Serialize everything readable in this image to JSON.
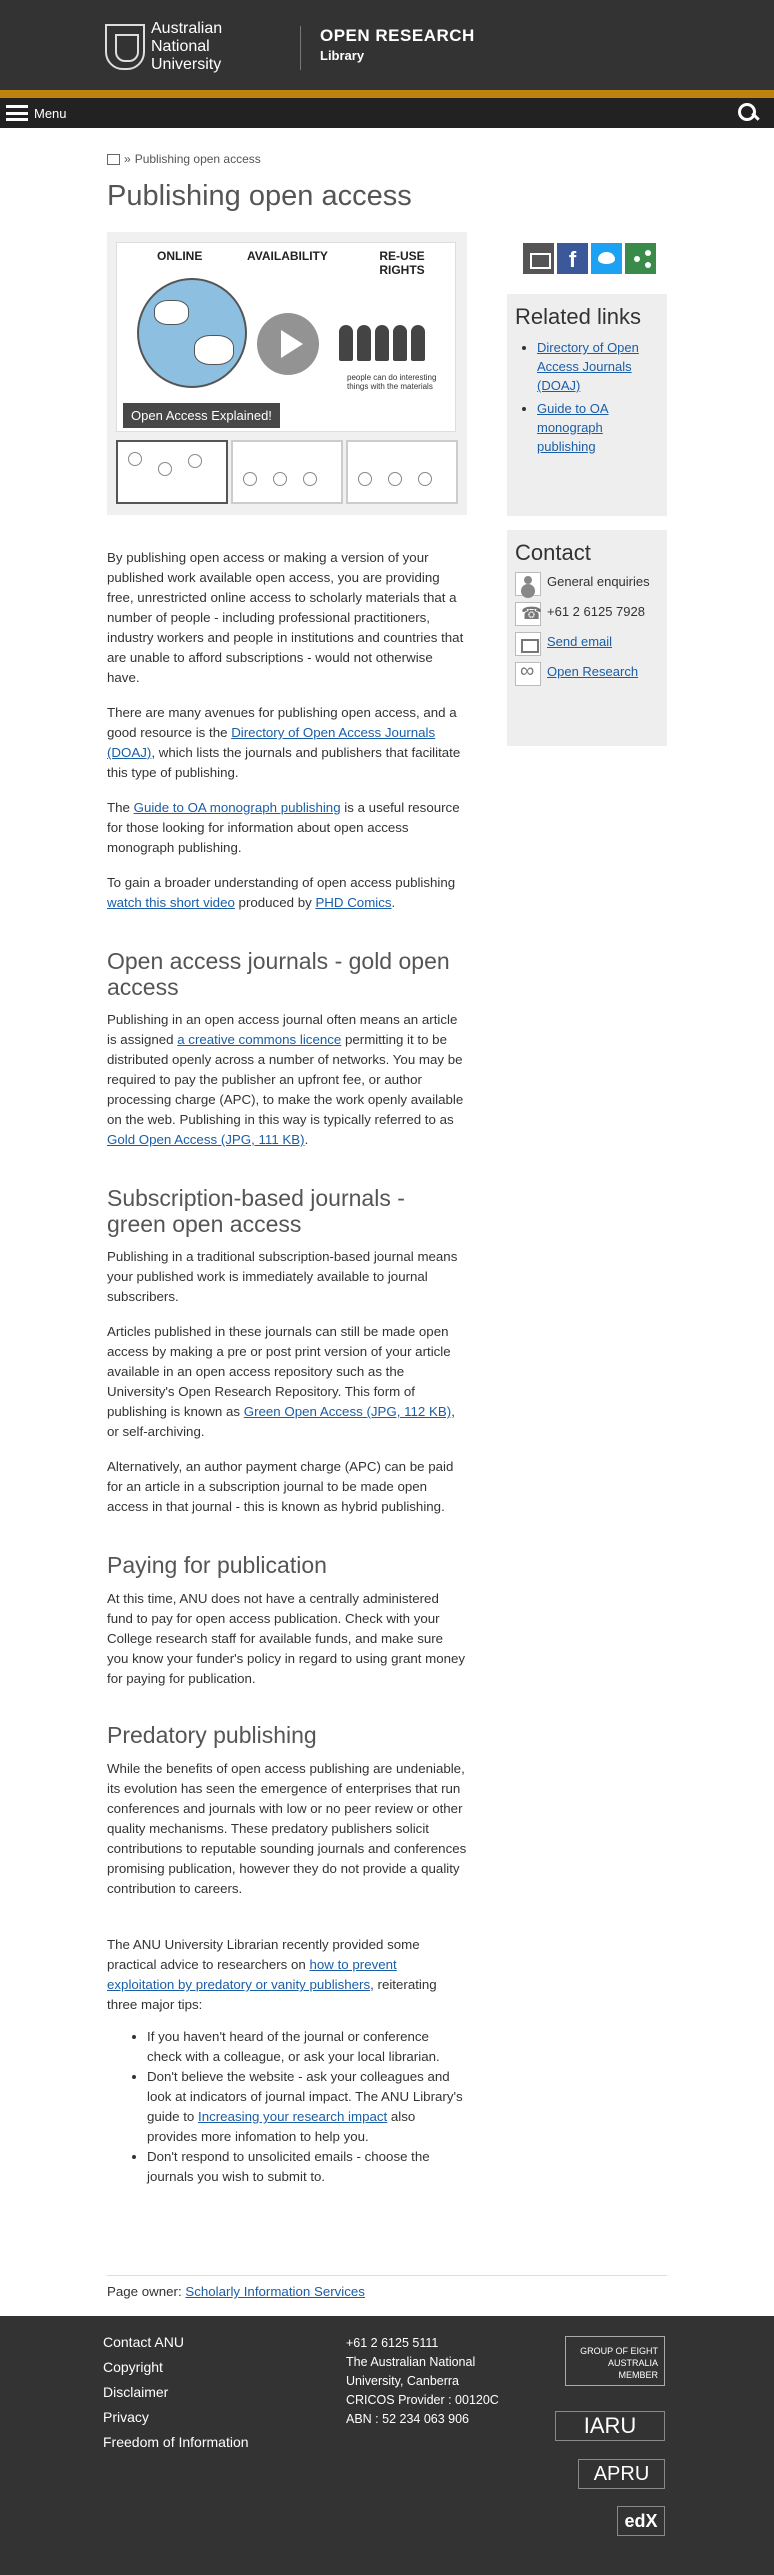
{
  "header": {
    "logo_line1": "Australian",
    "logo_line2": "National",
    "logo_line3": "University",
    "site_title": "OPEN RESEARCH",
    "site_subtitle": "Library",
    "menu_label": "Menu"
  },
  "breadcrumb": {
    "separator": "»",
    "current": "Publishing open access"
  },
  "page_title": "Publishing open access",
  "video": {
    "heading_online": "ONLINE",
    "heading_availability": "AVAILABILITY",
    "heading_reuse": "RE-USE RIGHTS",
    "bubble": "people can do interesting things with the materials",
    "caption": "Open Access Explained!"
  },
  "intro": "By publishing open access or making a version of your published work available open access, you are providing free, unrestricted online access to scholarly materials that a number of people - including professional practitioners, industry workers and people in institutions and countries that are unable to afford subscriptions - would not otherwise have.",
  "avenues": {
    "before": "There are many avenues for publishing open access, and a good resource is the ",
    "link": "Directory of Open Access Journals (DOAJ)",
    "after": ", which lists the journals and publishers that facilitate this type of publishing."
  },
  "monograph": {
    "before": "The ",
    "link": "Guide to OA monograph publishing",
    "after": " is a useful resource for those looking for information about open access monograph publishing."
  },
  "video_para": {
    "before": "To gain a broader understanding of open access publishing ",
    "link1": "watch this short video",
    "middle": " produced by ",
    "link2": "PHD Comics",
    "after": "."
  },
  "gold": {
    "heading": "Open access journals - gold open access",
    "p1_before": "Publishing in an open access journal often means an article is assigned ",
    "p1_link": "a creative commons licence",
    "p1_after": " permitting it to be distributed openly across a number of networks. You may be required to pay the publisher an upfront fee, or author processing charge (APC), to make the work openly available on the web. Publishing in this way is typically referred to as ",
    "p1_link2": "Gold Open Access (JPG, 111 KB)",
    "p1_end": "."
  },
  "green": {
    "heading": "Subscription-based journals - green open access",
    "p1": "Publishing in a traditional subscription-based journal means your published work is immediately available to journal subscribers.",
    "p2_before": "Articles published in these journals can still be made open access by making a pre or post print version of your article available in an open access repository such as the University's Open Research Repository. This form of publishing is known as ",
    "p2_link": "Green Open Access (JPG, 112 KB)",
    "p2_after": ", or self-archiving.",
    "p3": "Alternatively, an author payment charge (APC) can be paid for an article in a subscription journal to be made open access in that journal - this is known as hybrid publishing."
  },
  "paying": {
    "heading": "Paying for publication",
    "p1": "At this time, ANU does not have a centrally administered fund to pay for open access publication. Check with your College research staff for available funds, and make sure you know your funder's policy in regard to using grant money for paying for publication."
  },
  "predatory": {
    "heading": "Predatory publishing",
    "p1": "While the benefits of open access publishing are undeniable, its evolution has seen the emergence of enterprises that run conferences and journals with low or no peer review or other quality mechanisms. These predatory publishers solicit contributions to reputable sounding journals and conferences promising publication, however they do not provide a quality contribution to careers.",
    "p2_before": "The ANU University Librarian recently provided some practical advice to researchers on ",
    "p2_link": "how to prevent exploitation by predatory or vanity publishers",
    "p2_after": ", reiterating three major tips:",
    "tip1": "If you haven't heard of the journal or conference check with a colleague, or ask your local librarian.",
    "tip2_before": "Don't believe the website - ask your colleagues and look at indicators of journal impact. The ANU Library's guide to ",
    "tip2_link": "Increasing your research impact",
    "tip2_after": " also provides more infomation to help you.",
    "tip3": "Don't respond to unsolicited emails - choose the journals you wish to submit to."
  },
  "page_owner": {
    "label": "Page owner: ",
    "link": "Scholarly Information Services"
  },
  "related": {
    "heading": "Related links",
    "items": [
      "Directory of Open Access Journals (DOAJ)",
      "Guide to OA monograph publishing"
    ]
  },
  "contact": {
    "heading": "Contact",
    "general": "General enquiries",
    "phone": "+61 2 6125 7928",
    "email": "Send email",
    "web": "Open Research"
  },
  "footer": {
    "links": [
      "Contact ANU",
      "Copyright",
      "Disclaimer",
      "Privacy",
      "Freedom of Information"
    ],
    "phone": "+61 2 6125 5111",
    "org": "The Australian National University, Canberra",
    "cricos": "CRICOS Provider : 00120C",
    "abn": "ABN : 52 234 063 906",
    "badge_go8_1": "GROUP OF EIGHT",
    "badge_go8_2": "AUSTRALIA",
    "badge_go8_3": "MEMBER",
    "badge_iaru": "IARU",
    "badge_apru": "APRU",
    "badge_edx": "edX"
  },
  "colors": {
    "header_bg": "#333333",
    "gold_bar": "#be830e",
    "link": "#1a5ea8"
  }
}
